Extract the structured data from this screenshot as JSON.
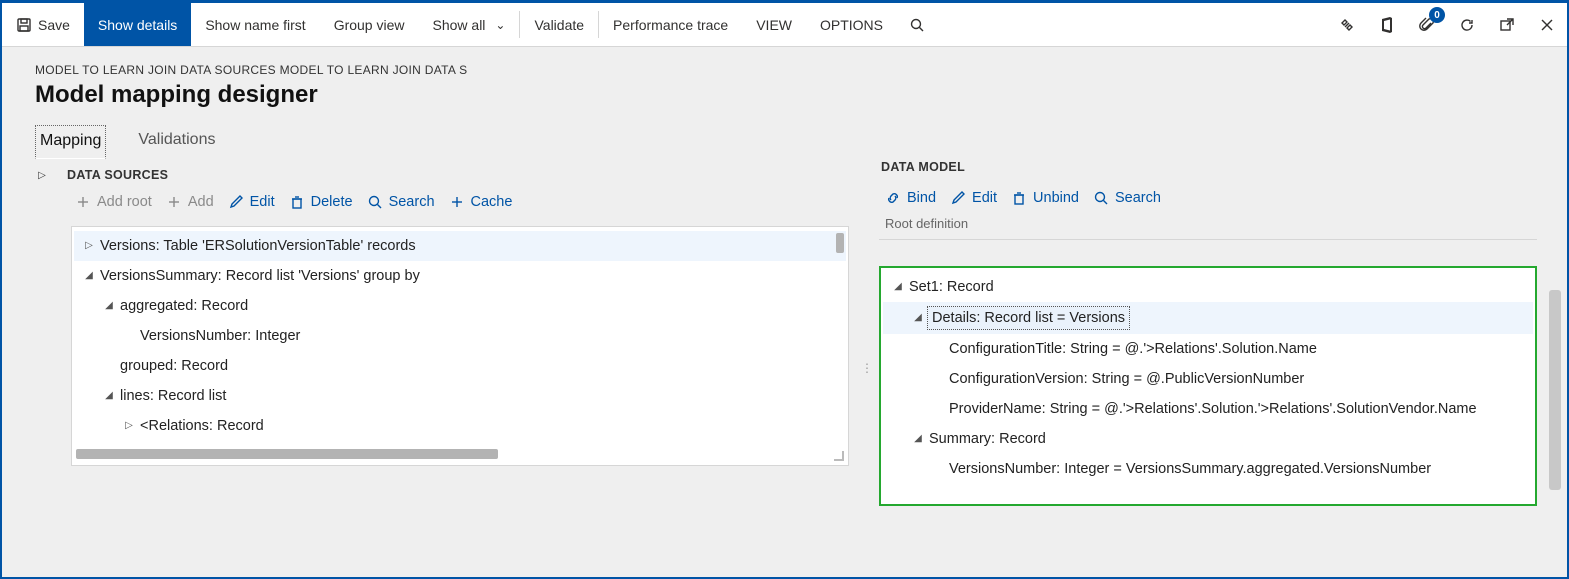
{
  "toolbar": {
    "save": "Save",
    "showDetails": "Show details",
    "showNameFirst": "Show name first",
    "groupView": "Group view",
    "showAll": "Show all",
    "validate": "Validate",
    "perfTrace": "Performance trace",
    "view": "VIEW",
    "options": "OPTIONS",
    "attachBadge": "0"
  },
  "breadcrumb": "MODEL TO LEARN JOIN DATA SOURCES MODEL TO LEARN JOIN DATA S",
  "pageTitle": "Model mapping designer",
  "tabs": {
    "mapping": "Mapping",
    "validations": "Validations"
  },
  "dataSources": {
    "heading": "DATA SOURCES",
    "actions": {
      "addRoot": "Add root",
      "add": "Add",
      "edit": "Edit",
      "delete": "Delete",
      "search": "Search",
      "cache": "Cache"
    },
    "tree": [
      {
        "indent": 0,
        "toggle": "▷",
        "label": "Versions: Table 'ERSolutionVersionTable' records",
        "selLight": true
      },
      {
        "indent": 0,
        "toggle": "◢",
        "label": "VersionsSummary: Record list 'Versions' group by"
      },
      {
        "indent": 1,
        "toggle": "◢",
        "label": "aggregated: Record"
      },
      {
        "indent": 2,
        "toggle": "",
        "label": "VersionsNumber: Integer"
      },
      {
        "indent": 1,
        "toggle": "",
        "label": "grouped: Record"
      },
      {
        "indent": 1,
        "toggle": "◢",
        "label": "lines: Record list"
      },
      {
        "indent": 2,
        "toggle": "▷",
        "label": "<Relations: Record"
      }
    ]
  },
  "dataModel": {
    "heading": "DATA MODEL",
    "actions": {
      "bind": "Bind",
      "edit": "Edit",
      "unbind": "Unbind",
      "search": "Search"
    },
    "rootDef": "Root definition",
    "tree": [
      {
        "indent": 0,
        "toggle": "◢",
        "label": "Set1: Record"
      },
      {
        "indent": 1,
        "toggle": "◢",
        "label": "Details: Record list = Versions",
        "selBox": true,
        "selLight": true
      },
      {
        "indent": 2,
        "toggle": "",
        "label": "ConfigurationTitle: String = @.'>Relations'.Solution.Name"
      },
      {
        "indent": 2,
        "toggle": "",
        "label": "ConfigurationVersion: String = @.PublicVersionNumber"
      },
      {
        "indent": 2,
        "toggle": "",
        "label": "ProviderName: String = @.'>Relations'.Solution.'>Relations'.SolutionVendor.Name"
      },
      {
        "indent": 1,
        "toggle": "◢",
        "label": "Summary: Record"
      },
      {
        "indent": 2,
        "toggle": "",
        "label": "VersionsNumber: Integer = VersionsSummary.aggregated.VersionsNumber"
      }
    ]
  }
}
